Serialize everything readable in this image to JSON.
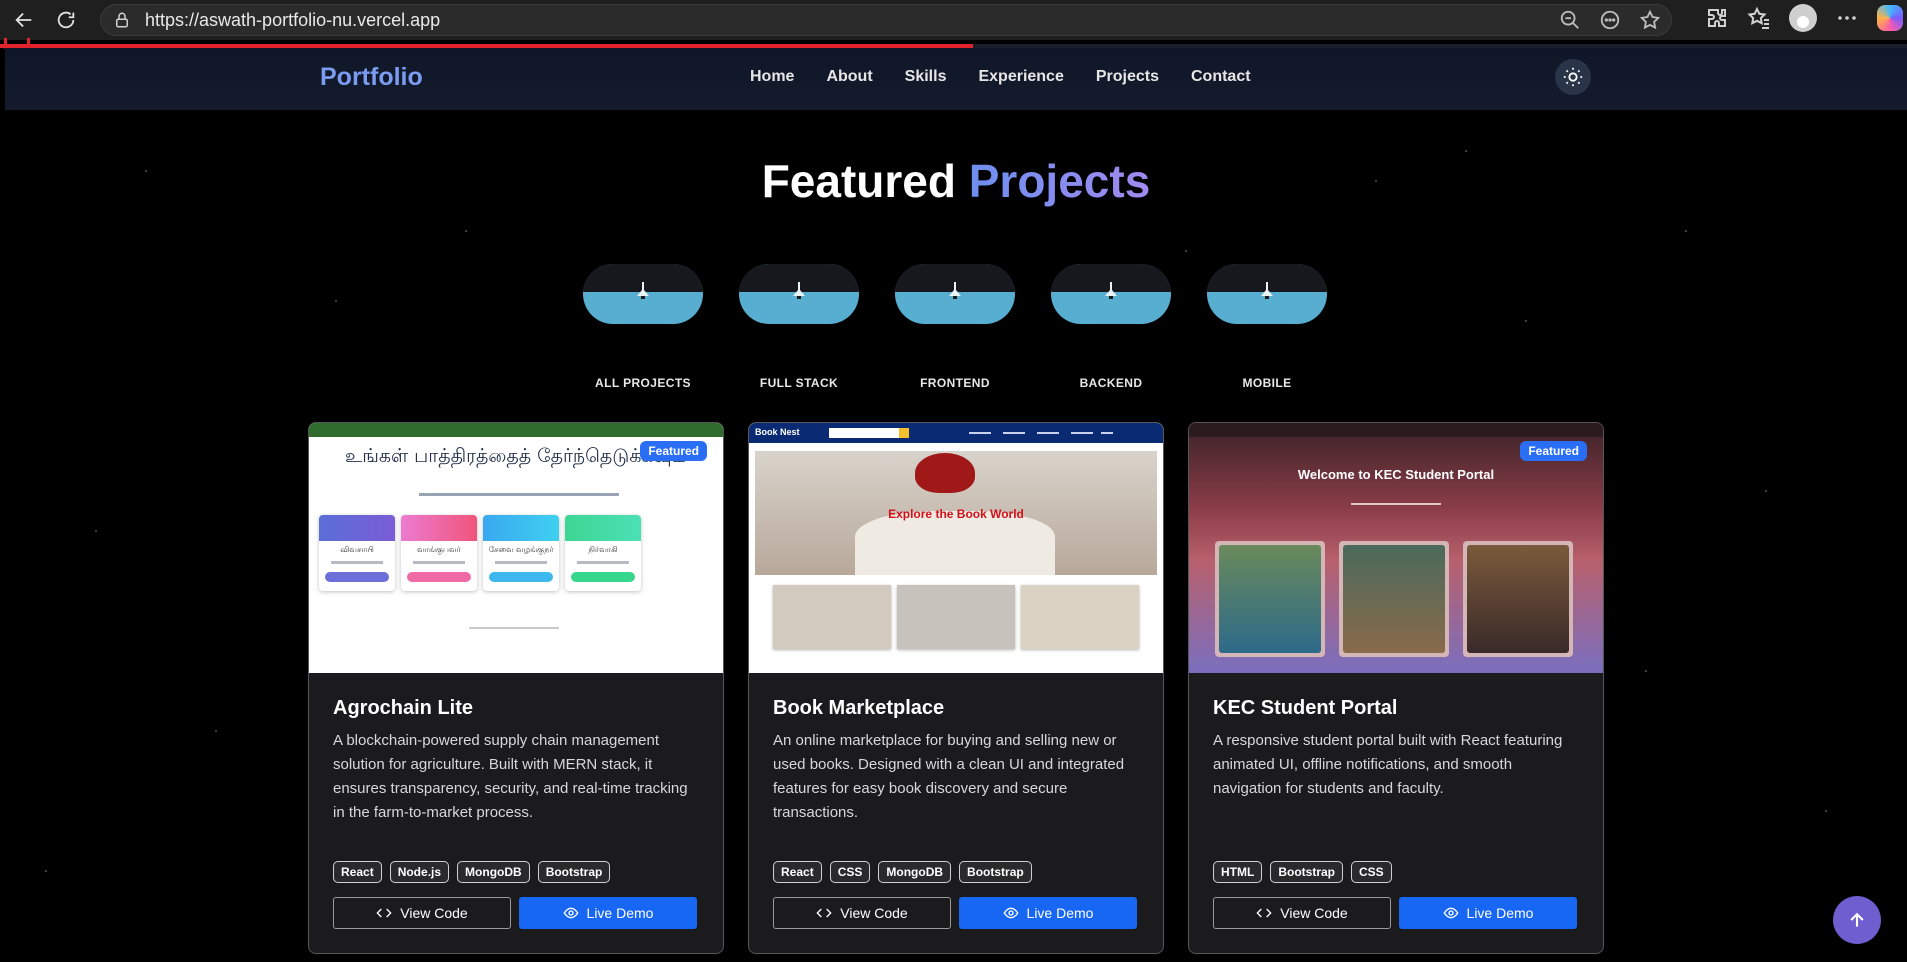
{
  "browser": {
    "url": "https://aswath-portfolio-nu.vercel.app",
    "scroll_progress": 0.51
  },
  "nav": {
    "brand": "Portfolio",
    "links": [
      "Home",
      "About",
      "Skills",
      "Experience",
      "Projects",
      "Contact"
    ]
  },
  "section": {
    "title_part1": "Featured",
    "title_part2": "Projects"
  },
  "filters": [
    "ALL PROJECTS",
    "FULL STACK",
    "FRONTEND",
    "BACKEND",
    "MOBILE"
  ],
  "projects": [
    {
      "title": "Agrochain Lite",
      "description": "A blockchain-powered supply chain management solution for agriculture. Built with MERN stack, it ensures transparency, security, and real-time tracking in the farm-to-market process.",
      "badge": "Featured",
      "tags": [
        "React",
        "Node.js",
        "MongoDB",
        "Bootstrap"
      ],
      "code_label": "View Code",
      "demo_label": "Live Demo",
      "thumb": {
        "heading": "உங்கள் பாத்திரத்தைத் தேர்ந்தெடுக்கவும்",
        "roles": [
          "விவசாயி",
          "வாங்குபவர்",
          "சேவை வழங்குநர்",
          "நிர்வாகி"
        ]
      }
    },
    {
      "title": "Book Marketplace",
      "description": "An online marketplace for buying and selling new or used books. Designed with a clean UI and integrated features for easy book discovery and secure transactions.",
      "badge": "",
      "tags": [
        "React",
        "CSS",
        "MongoDB",
        "Bootstrap"
      ],
      "code_label": "View Code",
      "demo_label": "Live Demo",
      "thumb": {
        "brand": "Book Nest",
        "slogan": "Explore the Book World"
      }
    },
    {
      "title": "KEC Student Portal",
      "description": "A responsive student portal built with React featuring animated UI, offline notifications, and smooth navigation for students and faculty.",
      "badge": "Featured",
      "tags": [
        "HTML",
        "Bootstrap",
        "CSS"
      ],
      "code_label": "View Code",
      "demo_label": "Live Demo",
      "thumb": {
        "heading": "Welcome to KEC Student Portal"
      }
    }
  ],
  "colors": {
    "accent": "#1867f4",
    "brand": "#7b9cf0",
    "filter_pill": "#58aed0",
    "progress": "#e2222c",
    "back_to_top": "#6e5ed0"
  }
}
